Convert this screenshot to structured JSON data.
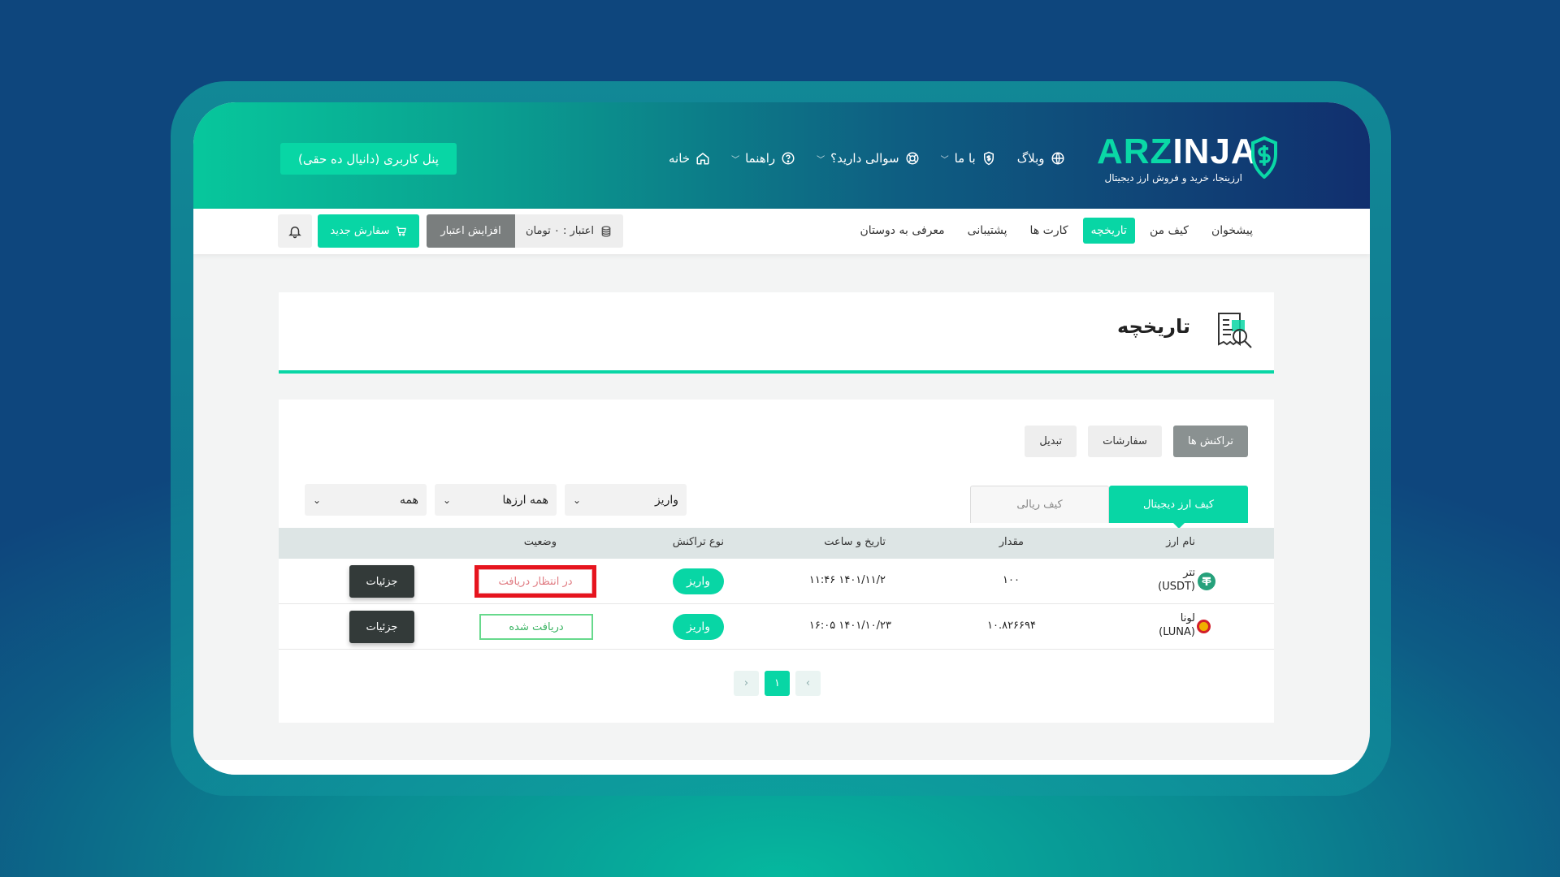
{
  "header": {
    "logo_text_a": "ARZ",
    "logo_text_b": "INJA",
    "logo_sub": "ارزینجا، خرید و فروش ارز دیجیتال",
    "panel_button": "پنل کاربری (دانیال ده حقی)",
    "nav": [
      {
        "label": "خانه",
        "icon": "home-icon"
      },
      {
        "label": "راهنما",
        "icon": "help-circle-icon",
        "dropdown": true
      },
      {
        "label": "سوالی دارید؟",
        "icon": "lifebuoy-icon",
        "dropdown": true
      },
      {
        "label": "با ما",
        "icon": "dollar-shield-icon",
        "dropdown": true
      },
      {
        "label": "وبلاگ",
        "icon": "globe-icon"
      }
    ]
  },
  "subnav": {
    "items": [
      "پیشخوان",
      "کیف من",
      "تاریخچه",
      "کارت ها",
      "پشتیبانی",
      "معرفی به دوستان"
    ],
    "active": "تاریخچه",
    "credit": "اعتبار : ۰ تومان",
    "increase": "افزایش اعتبار",
    "new_order": "سفارش جدید"
  },
  "page": {
    "title": "تاریخچه"
  },
  "tabs": [
    "تراکنش ها",
    "سفارشات",
    "تبدیل"
  ],
  "wallet_tabs": [
    "کیف ارز دیجیتال",
    "کیف ریالی"
  ],
  "filters": {
    "type": "واریز",
    "currency": "همه ارزها",
    "status": "همه"
  },
  "table": {
    "headers": {
      "name": "نام ارز",
      "amount": "مقدار",
      "datetime": "تاریخ و ساعت",
      "type": "نوع تراکنش",
      "status": "وضعیت"
    },
    "rows": [
      {
        "name": "تتر",
        "symbol": "(USDT)",
        "amount": "۱۰۰",
        "datetime": "۱۴۰۱/۱۱/۲ ۱۱:۴۶",
        "type": "واریز",
        "status": "در انتظار دریافت",
        "action": "جزئیات"
      },
      {
        "name": "لونا",
        "symbol": "(LUNA)",
        "amount": "۱۰.۸۲۶۶۹۴",
        "datetime": "۱۴۰۱/۱۰/۲۳ ۱۶:۰۵",
        "type": "واریز",
        "status": "دریافت شده",
        "action": "جزئیات"
      }
    ]
  },
  "pagination": {
    "current": "۱",
    "prev": "‹",
    "next": "›"
  },
  "colors": {
    "accent": "#08d6a5",
    "pending": "#e6141e",
    "done": "#3bb463"
  }
}
